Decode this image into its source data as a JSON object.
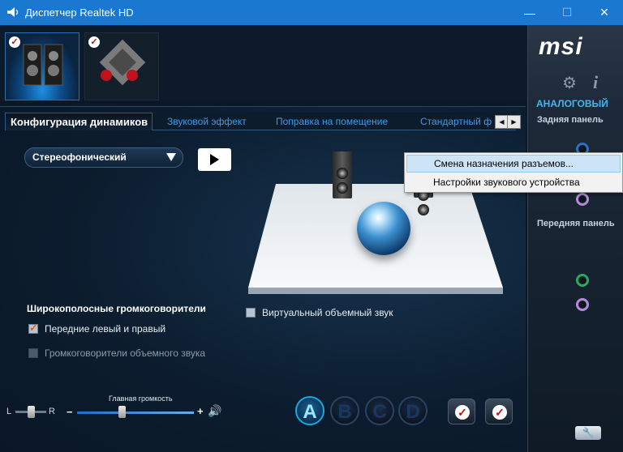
{
  "window": {
    "title": "Диспетчер Realtek HD",
    "minimize": "—",
    "maximize": "☐",
    "close": "✕"
  },
  "tabs": [
    {
      "label": "Конфигурация динамиков",
      "active": true
    },
    {
      "label": "Звуковой эффект",
      "active": false
    },
    {
      "label": "Поправка на помещение",
      "active": false
    },
    {
      "label": "Стандартный ф",
      "active": false
    }
  ],
  "tab_scroll": {
    "left": "◀",
    "right": "▶"
  },
  "speaker_config": {
    "selected": "Стереофонический"
  },
  "virtual_surround": {
    "label": "Виртуальный объемный звук",
    "checked": false
  },
  "fullrange": {
    "title": "Широкополосные громкоговорители",
    "front_label": "Передние левый и правый",
    "front_checked": true,
    "surround_label": "Громкоговорители объемного звука",
    "surround_checked": false
  },
  "volume": {
    "title": "Главная громкость",
    "balance_left": "L",
    "balance_right": "R",
    "minus": "−",
    "plus": "+",
    "speaker_glyph": "🔊",
    "level": 0.38,
    "balance": 0.5
  },
  "profiles": [
    "A",
    "B",
    "C",
    "D"
  ],
  "right_panel": {
    "brand": "msi",
    "section": "АНАЛОГОВЫЙ",
    "rear_label": "Задняя панель",
    "front_label": "Передняя панель",
    "gear": "⚙",
    "info": "i",
    "wrench": "🔧"
  },
  "context_menu": {
    "items": [
      "Смена назначения разъемов...",
      "Настройки звукового устройства"
    ]
  },
  "colors": {
    "accent": "#1b78d0",
    "tab_text": "#3a9bea",
    "analog": "#3fb6ee"
  }
}
